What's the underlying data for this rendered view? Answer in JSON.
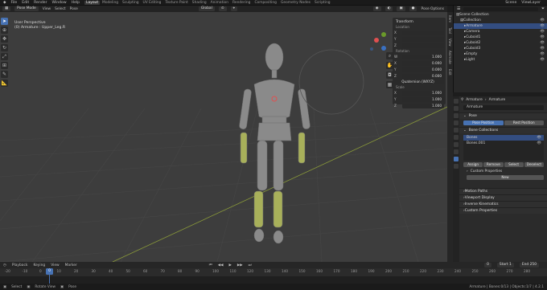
{
  "menu": {
    "items": [
      "File",
      "Edit",
      "Render",
      "Window",
      "Help"
    ],
    "workspaces": [
      "Layout",
      "Modeling",
      "Sculpting",
      "UV Editing",
      "Texture Paint",
      "Shading",
      "Animation",
      "Rendering",
      "Compositing",
      "Geometry Nodes",
      "Scripting"
    ],
    "active_workspace": "Layout",
    "scene_label": "Scene",
    "view_layer_label": "ViewLayer"
  },
  "viewport": {
    "mode": "Pose Mode",
    "menus": [
      "View",
      "Select",
      "Pose"
    ],
    "orientation": "Global",
    "overlay_line1": "User Perspective",
    "overlay_line2": "(0) Armature : Upper_Leg.R",
    "pose_options": "Pose Options"
  },
  "npanel": {
    "header": "Transform",
    "location_label": "Location",
    "rotation_label": "Rotation",
    "rotation_mode": "Quaternion (WXYZ)",
    "scale_label": "Scale",
    "location": [
      {
        "axis": "X",
        "value": ""
      },
      {
        "axis": "Y",
        "value": ""
      },
      {
        "axis": "Z",
        "value": ""
      }
    ],
    "rotation": [
      {
        "axis": "W",
        "value": "1.000"
      },
      {
        "axis": "X",
        "value": "0.000"
      },
      {
        "axis": "Y",
        "value": "0.000"
      },
      {
        "axis": "Z",
        "value": "0.000"
      }
    ],
    "scale": [
      {
        "axis": "X",
        "value": "1.000"
      },
      {
        "axis": "Y",
        "value": "1.000"
      },
      {
        "axis": "Z",
        "value": "1.000"
      }
    ],
    "tabs": [
      "Item",
      "Tool",
      "View",
      "Animate",
      "Edit"
    ]
  },
  "outliner": {
    "title": "Scene Collection",
    "rows": [
      {
        "label": "Scene Collection",
        "indent": 0,
        "selected": false
      },
      {
        "label": "Collection",
        "indent": 1,
        "selected": false
      },
      {
        "label": "Armature",
        "indent": 2,
        "selected": true
      },
      {
        "label": "Camera",
        "indent": 2,
        "selected": false
      },
      {
        "label": "Cuboid1",
        "indent": 2,
        "selected": false
      },
      {
        "label": "Cuboid2",
        "indent": 2,
        "selected": false
      },
      {
        "label": "Cuboid3",
        "indent": 2,
        "selected": false
      },
      {
        "label": "Empty",
        "indent": 2,
        "selected": false
      },
      {
        "label": "Light",
        "indent": 2,
        "selected": false
      }
    ]
  },
  "properties": {
    "breadcrumb_obj": "Armature",
    "breadcrumb_data": "Armature",
    "name_field": "Armature",
    "pose_section": "Pose",
    "pose_position": "Pose Position",
    "rest_position": "Rest Position",
    "bone_collections": "Bone Collections",
    "collections": [
      {
        "label": "Bones",
        "selected": true
      },
      {
        "label": "Bones.001",
        "selected": false
      }
    ],
    "assign": "Assign",
    "remove": "Remove",
    "select": "Select",
    "deselect": "Deselect",
    "custom_props": "Custom Properties",
    "new_button": "New",
    "sections": [
      "Motion Paths",
      "Viewport Display",
      "Inverse Kinematics",
      "Custom Properties"
    ]
  },
  "timeline": {
    "menus": [
      "Playback",
      "Keying",
      "View",
      "Marker"
    ],
    "current_frame": "0",
    "start_label": "Start",
    "start": "1",
    "end_label": "End",
    "end": "250",
    "ticks": [
      "-20",
      "-10",
      "0",
      "10",
      "20",
      "30",
      "40",
      "50",
      "60",
      "70",
      "80",
      "90",
      "100",
      "110",
      "120",
      "130",
      "140",
      "150",
      "160",
      "170",
      "180",
      "190",
      "200",
      "210",
      "220",
      "230",
      "240",
      "250",
      "260",
      "270",
      "280"
    ]
  },
  "status": {
    "left": [
      "Select",
      "Rotate View",
      "Pose"
    ],
    "right": "Armature | Bones:0/13 | Objects:1/7 | 4.2.1"
  }
}
